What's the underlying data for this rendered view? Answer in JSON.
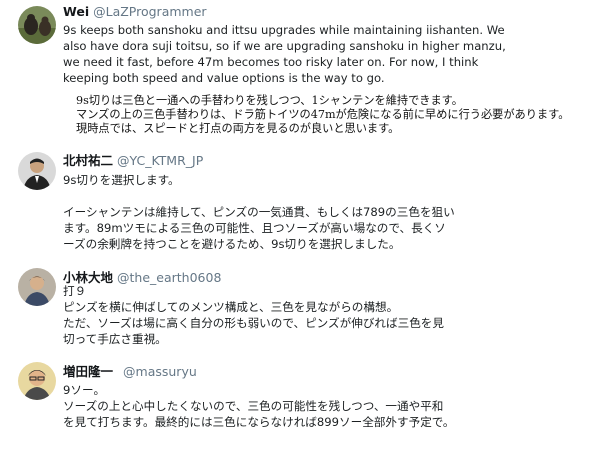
{
  "tweets": [
    {
      "author": "Wei",
      "handle": "@LaZProgrammer",
      "avatar_icon": "bear-photo-avatar",
      "body": [
        "9s keeps both sanshoku and ittsu upgrades while maintaining iishanten. We",
        "also have dora suji toitsu, so if we are upgrading sanshoku in higher manzu,",
        "we need it fast, before 47m becomes too risky later on. For now, I think",
        "keeping both speed and value options is the way to go."
      ],
      "quote": [
        "9s切りは三色と一通への手替わりを残しつつ、1シャンテンを維持できます。",
        "マンズの上の三色手替わりは、ドラ筋トイツの47mが危険になる前に早めに行う必要があります。",
        "現時点では、スピードと打点の両方を見るのが良いと思います。"
      ]
    },
    {
      "author": "北村祐二",
      "handle": "@YC_KTMR_JP",
      "avatar_icon": "man-in-suit-avatar",
      "body": [
        "9s切りを選択します。",
        "",
        "イーシャンテンは維持して、ピンズの一気通貫、もしくは789の三色を狙い",
        "ます。89mツモによる三色の可能性、且つソーズが高い場なので、長くソ",
        "ーズの余剰牌を持つことを避けるため、9s切りを選択しました。"
      ]
    },
    {
      "author": "小林大地",
      "handle": "@the_earth0608",
      "avatar_icon": "person-portrait-avatar",
      "body": [
        "打９",
        "ピンズを横に伸ばしてのメンツ構成と、三色を見ながらの構想。",
        "ただ、ソーズは場に高く自分の形も弱いので、ピンズが伸びれば三色を見",
        "切って手広さ重視。"
      ]
    },
    {
      "author": "増田隆一",
      "handle": "@massuryu",
      "avatar_icon": "man-with-glasses-avatar",
      "body": [
        " 9ソー。",
        "ソーズの上と心中したくないので、三色の可能性を残しつつ、一通や平和",
        "を見て打ちます。最終的には三色にならなければ899ソー全部外す予定で。"
      ]
    }
  ]
}
